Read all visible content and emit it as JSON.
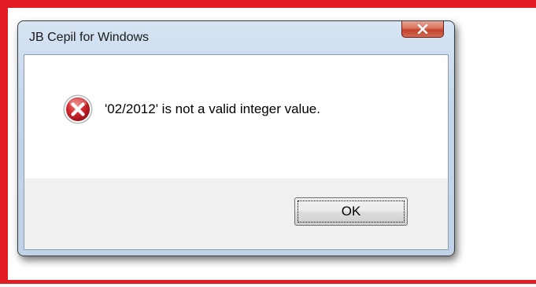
{
  "dialog": {
    "title": "JB Cepil for Windows",
    "message": "'02/2012' is not a valid integer value.",
    "icon": "error-icon",
    "ok_label": "OK",
    "close_icon": "close-icon"
  },
  "colors": {
    "annotation_frame": "#e31b23",
    "close_button": "#c4412a",
    "error_icon": "#c8202a"
  }
}
